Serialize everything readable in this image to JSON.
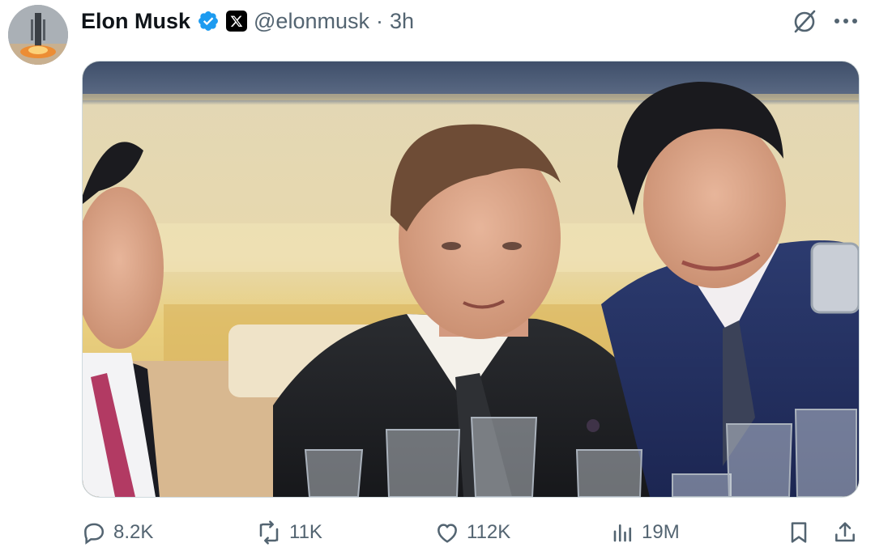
{
  "post": {
    "author_name": "Elon Musk",
    "handle": "@elonmusk",
    "separator": "·",
    "time": "3h",
    "verified_color": "#1d9bf0"
  },
  "actions": {
    "replies": "8.2K",
    "reposts": "11K",
    "likes": "112K",
    "views": "19M"
  },
  "icons": {
    "reply": "speech-bubble-icon",
    "repost": "repost-arrows-icon",
    "like": "heart-icon",
    "views": "bar-chart-icon",
    "bookmark": "bookmark-icon",
    "share": "share-upload-icon",
    "grok": "grok-slash-circle-icon",
    "more": "ellipsis-icon"
  },
  "colors": {
    "text_primary": "#0f1419",
    "text_secondary": "#536471",
    "border": "#cfd9de"
  }
}
